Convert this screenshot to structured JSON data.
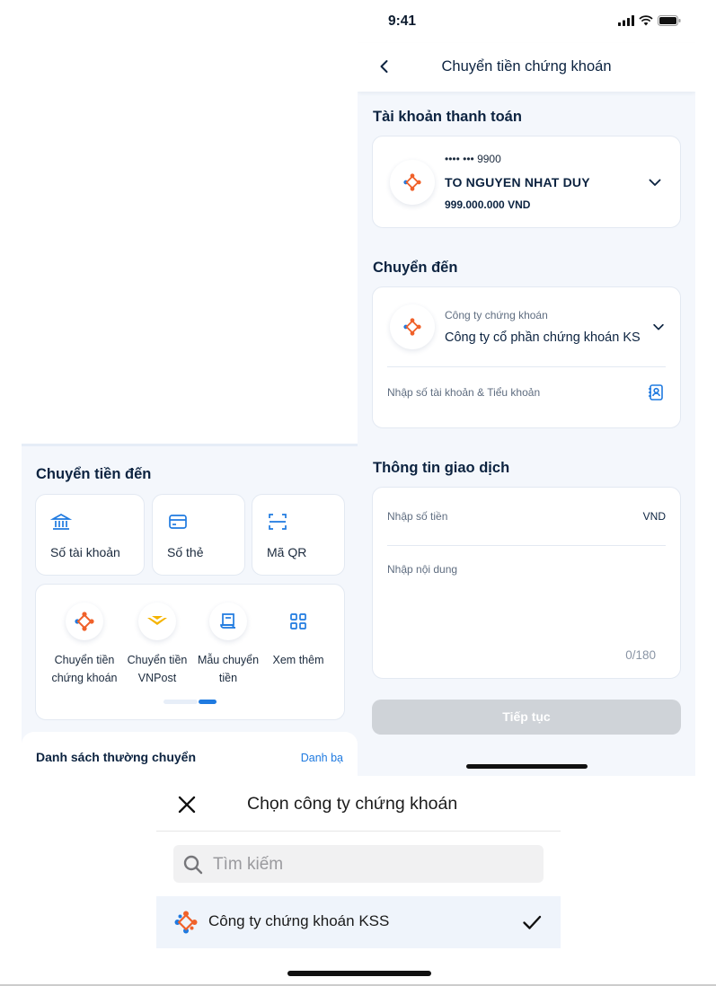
{
  "left_panel": {
    "title": "Chuyển tiền đến",
    "quick_options": [
      {
        "label": "Số tài khoản",
        "icon": "bank-icon"
      },
      {
        "label": "Số thẻ",
        "icon": "card-icon"
      },
      {
        "label": "Mã QR",
        "icon": "qr-scan-icon"
      }
    ],
    "features": [
      {
        "line1": "Chuyển tiền",
        "line2": "chứng khoán",
        "icon": "securities-logo-icon"
      },
      {
        "line1": "Chuyển tiền",
        "line2": "VNPost",
        "icon": "vnpost-icon"
      },
      {
        "line1": "Mẫu chuyển",
        "line2": "tiền",
        "icon": "template-icon"
      },
      {
        "line1": "Xem thêm",
        "line2": "",
        "icon": "more-grid-icon"
      }
    ],
    "list_title": "Danh sách thường chuyển",
    "list_link": "Danh bạ"
  },
  "status_bar": {
    "time": "9:41"
  },
  "header": {
    "title": "Chuyển tiền chứng khoán"
  },
  "payment_account": {
    "section_title": "Tài khoản thanh toán",
    "masked_number": "•••• ••• 9900",
    "name": "TO NGUYEN NHAT DUY",
    "balance": "999.000.000 VND"
  },
  "transfer_to": {
    "section_title": "Chuyển đến",
    "company_label": "Công ty chứng khoán",
    "company_value": "Công ty cổ phần chứng khoán KS",
    "account_placeholder": "Nhập số tài khoản & Tiểu khoản"
  },
  "transaction": {
    "section_title": "Thông tin giao dịch",
    "amount_placeholder": "Nhập số tiền",
    "currency": "VND",
    "content_placeholder": "Nhập nội dung",
    "char_count": "0/180"
  },
  "continue_button": "Tiếp tục",
  "sheet": {
    "title": "Chọn công ty chứng khoán",
    "search_placeholder": "Tìm kiếm",
    "options": [
      {
        "label": "Công ty chứng khoán KSS",
        "selected": true
      }
    ]
  },
  "colors": {
    "primary_blue": "#1f7ae0",
    "navy_text": "#0c2340",
    "disabled_button": "#cfd3d8",
    "selected_row": "#eff4fb",
    "logo_orange": "#f0612a",
    "vnpost_yellow": "#f5b400"
  }
}
